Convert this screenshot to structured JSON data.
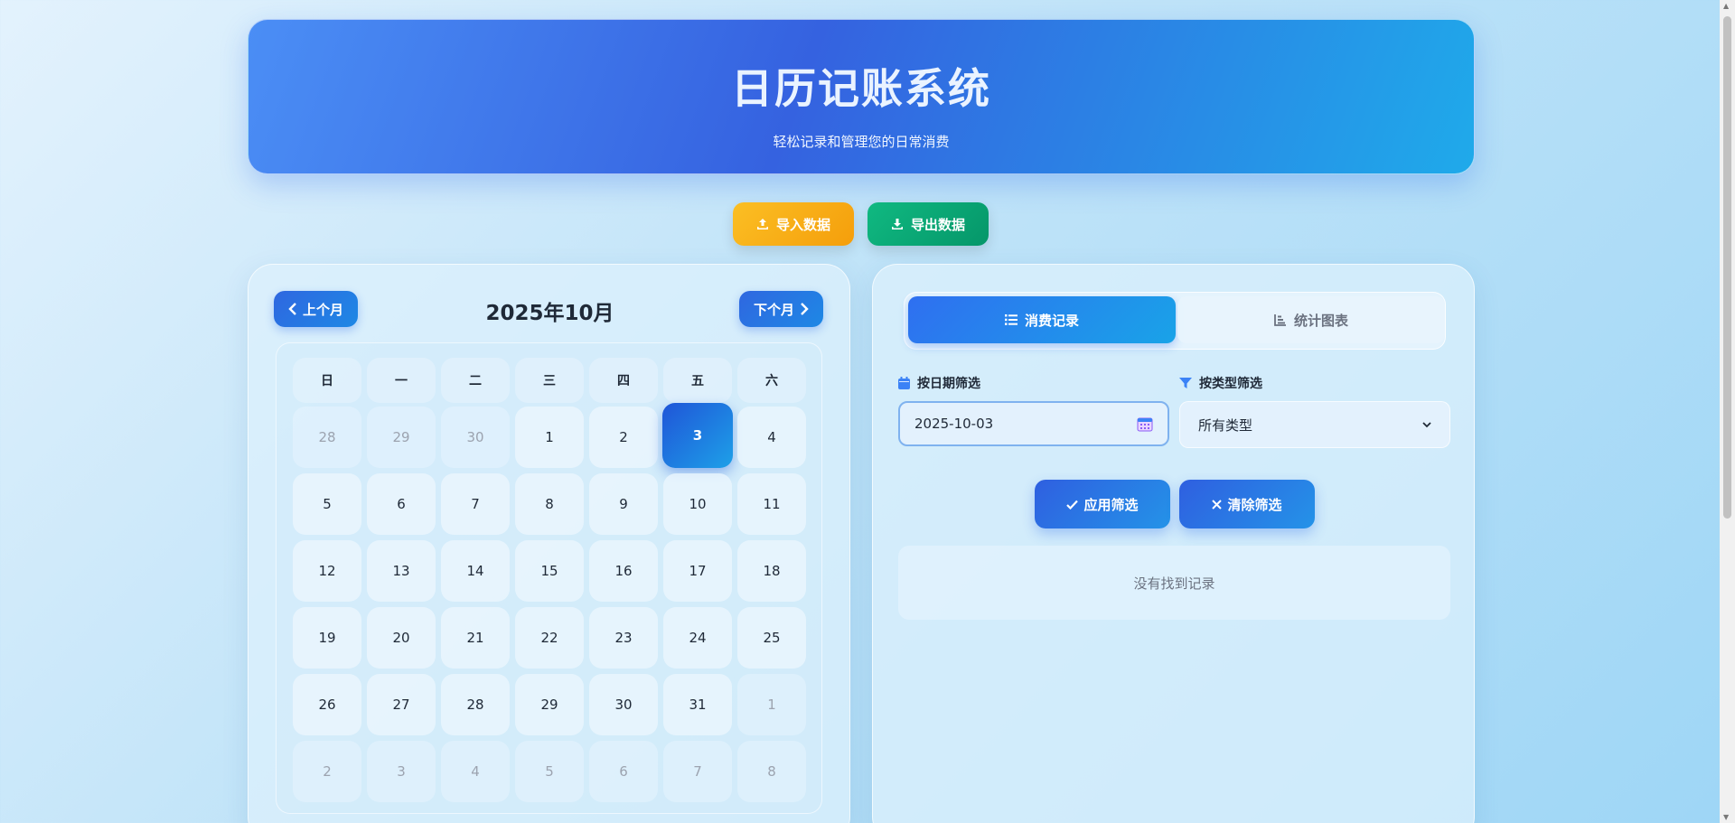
{
  "header": {
    "title": "日历记账系统",
    "subtitle": "轻松记录和管理您的日常消费"
  },
  "actions": {
    "import_label": "导入数据",
    "export_label": "导出数据"
  },
  "calendar": {
    "prev_label": "上个月",
    "next_label": "下个月",
    "month_title": "2025年10月",
    "weekdays": [
      "日",
      "一",
      "二",
      "三",
      "四",
      "五",
      "六"
    ],
    "days": [
      {
        "d": "28",
        "other": true
      },
      {
        "d": "29",
        "other": true
      },
      {
        "d": "30",
        "other": true
      },
      {
        "d": "1"
      },
      {
        "d": "2"
      },
      {
        "d": "3",
        "selected": true
      },
      {
        "d": "4"
      },
      {
        "d": "5"
      },
      {
        "d": "6"
      },
      {
        "d": "7"
      },
      {
        "d": "8"
      },
      {
        "d": "9"
      },
      {
        "d": "10"
      },
      {
        "d": "11"
      },
      {
        "d": "12"
      },
      {
        "d": "13"
      },
      {
        "d": "14"
      },
      {
        "d": "15"
      },
      {
        "d": "16"
      },
      {
        "d": "17"
      },
      {
        "d": "18"
      },
      {
        "d": "19"
      },
      {
        "d": "20"
      },
      {
        "d": "21"
      },
      {
        "d": "22"
      },
      {
        "d": "23"
      },
      {
        "d": "24"
      },
      {
        "d": "25"
      },
      {
        "d": "26"
      },
      {
        "d": "27"
      },
      {
        "d": "28"
      },
      {
        "d": "29"
      },
      {
        "d": "30"
      },
      {
        "d": "31"
      },
      {
        "d": "1",
        "other": true
      },
      {
        "d": "2",
        "other": true
      },
      {
        "d": "3",
        "other": true
      },
      {
        "d": "4",
        "other": true
      },
      {
        "d": "5",
        "other": true
      },
      {
        "d": "6",
        "other": true
      },
      {
        "d": "7",
        "other": true
      },
      {
        "d": "8",
        "other": true
      }
    ]
  },
  "records": {
    "tab_records": "消费记录",
    "tab_charts": "统计图表",
    "filter_date_label": "按日期筛选",
    "filter_type_label": "按类型筛选",
    "date_value": "2025-10-03",
    "type_selected": "所有类型",
    "apply_label": "应用筛选",
    "clear_label": "清除筛选",
    "empty_text": "没有找到记录"
  },
  "colors": {
    "accent": "#2f67e0",
    "import": "#f59e0b",
    "export": "#10b981"
  }
}
